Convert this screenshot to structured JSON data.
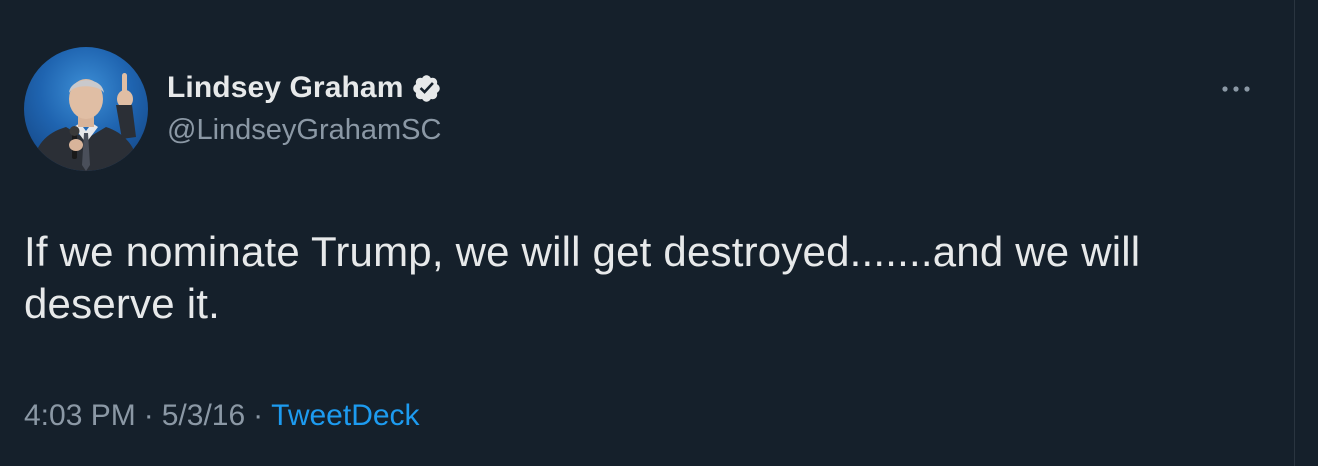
{
  "tweet": {
    "display_name": "Lindsey Graham",
    "handle": "@LindseyGrahamSC",
    "text": "If we nominate Trump, we will get destroyed.......and we will deserve it.",
    "time": "4:03 PM",
    "date": "5/3/16",
    "separator": "·",
    "source": "TweetDeck"
  },
  "icons": {
    "verified": "verified-badge-icon",
    "more": "more-options-icon"
  },
  "colors": {
    "background": "#15202b",
    "primary_text": "#e7e9ea",
    "secondary_text": "#8b98a5",
    "link": "#1d9bf0"
  }
}
